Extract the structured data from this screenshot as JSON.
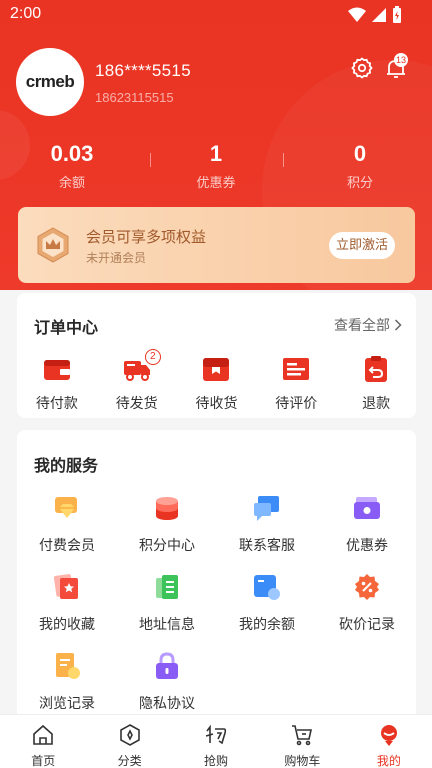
{
  "status_bar": {
    "time": "2:00"
  },
  "user": {
    "name": "186****5515",
    "phone": "18623115515",
    "avatar_text": "crmeb"
  },
  "notifications": {
    "count": "13"
  },
  "stats": [
    {
      "value": "0.03",
      "label": "余额"
    },
    {
      "value": "1",
      "label": "优惠券"
    },
    {
      "value": "0",
      "label": "积分"
    }
  ],
  "member": {
    "title": "会员可享多项权益",
    "subtitle": "未开通会员",
    "button": "立即激活"
  },
  "orders": {
    "title": "订单中心",
    "see_all": "查看全部",
    "items": [
      {
        "label": "待付款",
        "icon": "wallet-icon"
      },
      {
        "label": "待发货",
        "icon": "truck-icon",
        "badge": "2"
      },
      {
        "label": "待收货",
        "icon": "package-icon"
      },
      {
        "label": "待评价",
        "icon": "review-icon"
      },
      {
        "label": "退款",
        "icon": "refund-icon"
      }
    ]
  },
  "services": {
    "title": "我的服务",
    "items": [
      {
        "label": "付费会员",
        "icon": "diamond-icon"
      },
      {
        "label": "积分中心",
        "icon": "coins-stack-icon"
      },
      {
        "label": "联系客服",
        "icon": "chat-icon"
      },
      {
        "label": "优惠券",
        "icon": "coupon-wallet-icon"
      },
      {
        "label": "我的收藏",
        "icon": "favorite-star-icon"
      },
      {
        "label": "地址信息",
        "icon": "address-book-icon"
      },
      {
        "label": "我的余额",
        "icon": "balance-card-icon"
      },
      {
        "label": "砍价记录",
        "icon": "bargain-icon"
      },
      {
        "label": "浏览记录",
        "icon": "history-icon"
      },
      {
        "label": "隐私协议",
        "icon": "lock-icon"
      }
    ]
  },
  "tabbar": [
    {
      "label": "首页",
      "icon": "home-icon"
    },
    {
      "label": "分类",
      "icon": "category-icon"
    },
    {
      "label": "抢购",
      "icon": "flash-sale-icon"
    },
    {
      "label": "购物车",
      "icon": "cart-icon"
    },
    {
      "label": "我的",
      "icon": "profile-icon",
      "active": true
    }
  ],
  "colors": {
    "brand": "#e93323",
    "member_gold": "#a05a2c"
  }
}
